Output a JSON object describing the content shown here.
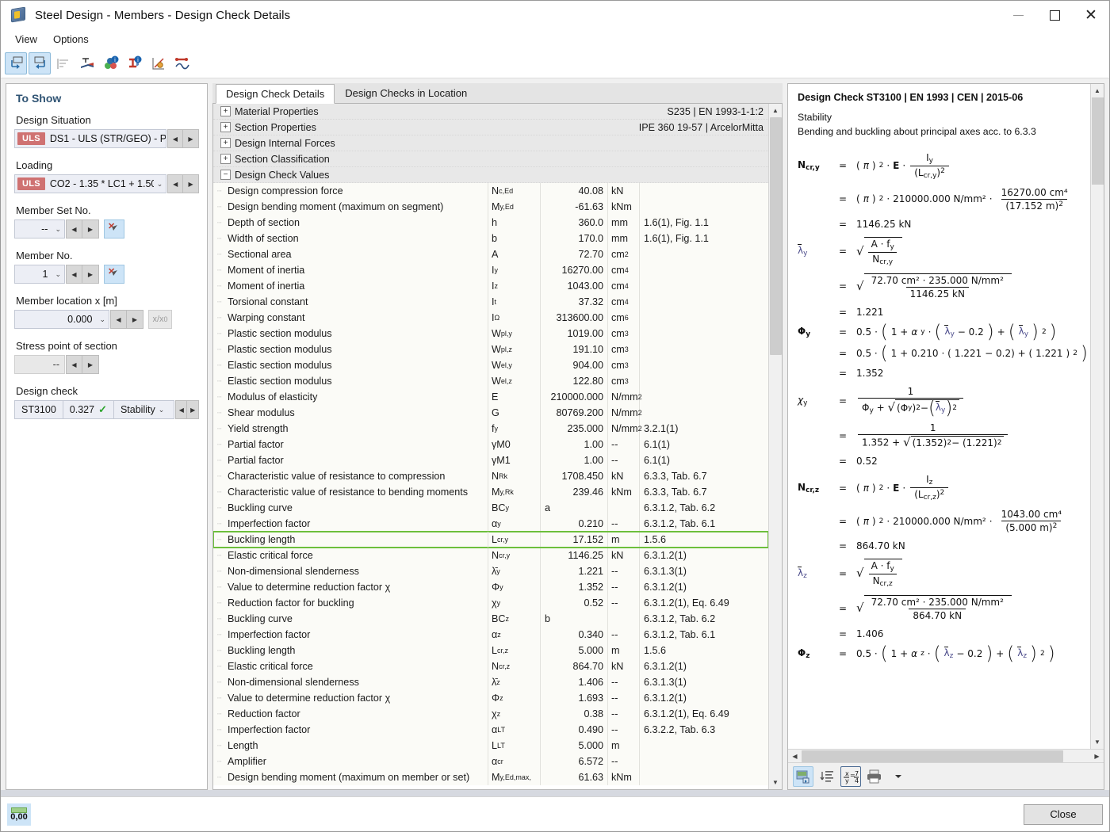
{
  "window": {
    "title": "Steel Design - Members - Design Check Details",
    "app_icon": "cube-icon",
    "minimize": "minimize-icon",
    "maximize": "maximize-icon",
    "close": "close-icon"
  },
  "menu": {
    "items": [
      "View",
      "Options"
    ]
  },
  "toolbar": {
    "buttons": [
      {
        "name": "previous-navigation-icon",
        "active": true
      },
      {
        "name": "next-navigation-icon",
        "active": true
      },
      {
        "name": "section-list-icon",
        "active": false
      },
      {
        "name": "stress-distribution-icon",
        "active": false
      },
      {
        "name": "material-info-icon",
        "active": false
      },
      {
        "name": "section-info-icon",
        "active": false
      },
      {
        "name": "diagram-icon",
        "active": false
      },
      {
        "name": "member-results-icon",
        "active": false
      }
    ]
  },
  "sidebar": {
    "title": "To Show",
    "design_situation": {
      "label": "Design Situation",
      "badge": "ULS",
      "value": "DS1 - ULS (STR/GEO) - P..."
    },
    "loading": {
      "label": "Loading",
      "badge": "ULS",
      "value": "CO2 - 1.35 * LC1 + 1.50 *"
    },
    "member_set_no": {
      "label": "Member Set No.",
      "value": "--"
    },
    "member_no": {
      "label": "Member No.",
      "value": "1"
    },
    "member_location": {
      "label": "Member location x [m]",
      "value": "0.000",
      "unit_button": "x/x",
      "unit_sub": "0"
    },
    "stress_point": {
      "label": "Stress point of section",
      "value": "--"
    },
    "design_check": {
      "label": "Design check",
      "id": "ST3100",
      "ratio": "0.327",
      "type": "Stability"
    }
  },
  "tabs": [
    {
      "label": "Design Check Details",
      "active": true
    },
    {
      "label": "Design Checks in Location",
      "active": false
    }
  ],
  "tree_groups": [
    {
      "name": "Material Properties",
      "expanded": false,
      "value": "S235 | EN 1993-1-1:2"
    },
    {
      "name": "Section Properties",
      "expanded": false,
      "value": "IPE 360 19-57 | ArcelorMitta"
    },
    {
      "name": "Design Internal Forces",
      "expanded": false,
      "value": ""
    },
    {
      "name": "Section Classification",
      "expanded": false,
      "value": ""
    },
    {
      "name": "Design Check Values",
      "expanded": true,
      "value": ""
    }
  ],
  "table": {
    "rows": [
      {
        "name": "Design compression force",
        "sym": "N",
        "sub": "c,Ed",
        "val": "40.08",
        "unit": "kN",
        "unit_sup": "",
        "ref": ""
      },
      {
        "name": "Design bending moment (maximum on segment)",
        "sym": "M",
        "sub": "y,Ed",
        "val": "-61.63",
        "unit": "kNm",
        "unit_sup": "",
        "ref": ""
      },
      {
        "name": "Depth of section",
        "sym": "h",
        "sub": "",
        "val": "360.0",
        "unit": "mm",
        "unit_sup": "",
        "ref": "1.6(1), Fig. 1.1"
      },
      {
        "name": "Width of section",
        "sym": "b",
        "sub": "",
        "val": "170.0",
        "unit": "mm",
        "unit_sup": "",
        "ref": "1.6(1), Fig. 1.1"
      },
      {
        "name": "Sectional area",
        "sym": "A",
        "sub": "",
        "val": "72.70",
        "unit": "cm",
        "unit_sup": "2",
        "ref": ""
      },
      {
        "name": "Moment of inertia",
        "sym": "I",
        "sub": "y",
        "val": "16270.00",
        "unit": "cm",
        "unit_sup": "4",
        "ref": ""
      },
      {
        "name": "Moment of inertia",
        "sym": "I",
        "sub": "z",
        "val": "1043.00",
        "unit": "cm",
        "unit_sup": "4",
        "ref": ""
      },
      {
        "name": "Torsional constant",
        "sym": "I",
        "sub": "t",
        "val": "37.32",
        "unit": "cm",
        "unit_sup": "4",
        "ref": ""
      },
      {
        "name": "Warping constant",
        "sym": "I",
        "sub": "Ω",
        "val": "313600.00",
        "unit": "cm",
        "unit_sup": "6",
        "ref": ""
      },
      {
        "name": "Plastic section modulus",
        "sym": "W",
        "sub": "pl,y",
        "val": "1019.00",
        "unit": "cm",
        "unit_sup": "3",
        "ref": ""
      },
      {
        "name": "Plastic section modulus",
        "sym": "W",
        "sub": "pl,z",
        "val": "191.10",
        "unit": "cm",
        "unit_sup": "3",
        "ref": ""
      },
      {
        "name": "Elastic section modulus",
        "sym": "W",
        "sub": "el,y",
        "val": "904.00",
        "unit": "cm",
        "unit_sup": "3",
        "ref": ""
      },
      {
        "name": "Elastic section modulus",
        "sym": "W",
        "sub": "el,z",
        "val": "122.80",
        "unit": "cm",
        "unit_sup": "3",
        "ref": ""
      },
      {
        "name": "Modulus of elasticity",
        "sym": "E",
        "sub": "",
        "val": "210000.000",
        "unit": "N/mm",
        "unit_sup": "2",
        "ref": ""
      },
      {
        "name": "Shear modulus",
        "sym": "G",
        "sub": "",
        "val": "80769.200",
        "unit": "N/mm",
        "unit_sup": "2",
        "ref": ""
      },
      {
        "name": "Yield strength",
        "sym": "f",
        "sub": "y",
        "val": "235.000",
        "unit": "N/mm",
        "unit_sup": "2",
        "ref": "3.2.1(1)"
      },
      {
        "name": "Partial factor",
        "sym": "γM0",
        "sub": "",
        "val": "1.00",
        "unit": "--",
        "unit_sup": "",
        "ref": "6.1(1)"
      },
      {
        "name": "Partial factor",
        "sym": "γM1",
        "sub": "",
        "val": "1.00",
        "unit": "--",
        "unit_sup": "",
        "ref": "6.1(1)"
      },
      {
        "name": "Characteristic value of resistance to compression",
        "sym": "N",
        "sub": "Rk",
        "val": "1708.450",
        "unit": "kN",
        "unit_sup": "",
        "ref": "6.3.3, Tab. 6.7"
      },
      {
        "name": "Characteristic value of resistance to bending moments",
        "sym": "M",
        "sub": "y,Rk",
        "val": "239.46",
        "unit": "kNm",
        "unit_sup": "",
        "ref": "6.3.3, Tab. 6.7"
      },
      {
        "name": "Buckling curve",
        "sym": "BC",
        "sub": "y",
        "val": "a",
        "unit": "",
        "unit_sup": "",
        "ref": "6.3.1.2, Tab. 6.2",
        "val_left": true
      },
      {
        "name": "Imperfection factor",
        "sym": "α",
        "sub": "y",
        "val": "0.210",
        "unit": "--",
        "unit_sup": "",
        "ref": "6.3.1.2, Tab. 6.1"
      },
      {
        "name": "Buckling length",
        "sym": "L",
        "sub": "cr,y",
        "val": "17.152",
        "unit": "m",
        "unit_sup": "",
        "ref": "1.5.6",
        "highlight": true
      },
      {
        "name": "Elastic critical force",
        "sym": "N",
        "sub": "cr,y",
        "val": "1146.25",
        "unit": "kN",
        "unit_sup": "",
        "ref": "6.3.1.2(1)"
      },
      {
        "name": "Non-dimensional slenderness",
        "sym": "λ̄",
        "sub": "y",
        "val": "1.221",
        "unit": "--",
        "unit_sup": "",
        "ref": "6.3.1.3(1)"
      },
      {
        "name": "Value to determine reduction factor χ",
        "sym": "Φ",
        "sub": "y",
        "val": "1.352",
        "unit": "--",
        "unit_sup": "",
        "ref": "6.3.1.2(1)"
      },
      {
        "name": "Reduction factor for buckling",
        "sym": "χ",
        "sub": "y",
        "val": "0.52",
        "unit": "--",
        "unit_sup": "",
        "ref": "6.3.1.2(1), Eq. 6.49"
      },
      {
        "name": "Buckling curve",
        "sym": "BC",
        "sub": "z",
        "val": "b",
        "unit": "",
        "unit_sup": "",
        "ref": "6.3.1.2, Tab. 6.2",
        "val_left": true
      },
      {
        "name": "Imperfection factor",
        "sym": "α",
        "sub": "z",
        "val": "0.340",
        "unit": "--",
        "unit_sup": "",
        "ref": "6.3.1.2, Tab. 6.1"
      },
      {
        "name": "Buckling length",
        "sym": "L",
        "sub": "cr,z",
        "val": "5.000",
        "unit": "m",
        "unit_sup": "",
        "ref": "1.5.6"
      },
      {
        "name": "Elastic critical force",
        "sym": "N",
        "sub": "cr,z",
        "val": "864.70",
        "unit": "kN",
        "unit_sup": "",
        "ref": "6.3.1.2(1)"
      },
      {
        "name": "Non-dimensional slenderness",
        "sym": "λ̄",
        "sub": "z",
        "val": "1.406",
        "unit": "--",
        "unit_sup": "",
        "ref": "6.3.1.3(1)"
      },
      {
        "name": "Value to determine reduction factor χ",
        "sym": "Φ",
        "sub": "z",
        "val": "1.693",
        "unit": "--",
        "unit_sup": "",
        "ref": "6.3.1.2(1)"
      },
      {
        "name": "Reduction factor",
        "sym": "χ",
        "sub": "z",
        "val": "0.38",
        "unit": "--",
        "unit_sup": "",
        "ref": "6.3.1.2(1), Eq. 6.49"
      },
      {
        "name": "Imperfection factor",
        "sym": "α",
        "sub": "LT",
        "val": "0.490",
        "unit": "--",
        "unit_sup": "",
        "ref": "6.3.2.2, Tab. 6.3"
      },
      {
        "name": "Length",
        "sym": "L",
        "sub": "LT",
        "val": "5.000",
        "unit": "m",
        "unit_sup": "",
        "ref": ""
      },
      {
        "name": "Amplifier",
        "sym": "α",
        "sub": "cr",
        "val": "6.572",
        "unit": "--",
        "unit_sup": "",
        "ref": ""
      },
      {
        "name": "Design bending moment (maximum on member or set)",
        "sym": "M",
        "sub": "y,Ed,max,",
        "val": "61.63",
        "unit": "kNm",
        "unit_sup": "",
        "ref": ""
      }
    ]
  },
  "detail": {
    "title": "Design Check ST3100 | EN 1993 | CEN | 2015-06",
    "subtitle_1": "Stability",
    "subtitle_2": "Bending and buckling about principal axes acc. to 6.3.3",
    "values": {
      "E": "210000.000 N/mm²",
      "Iy": "16270.00 cm⁴",
      "Iz": "1043.00 cm⁴",
      "Lcry": "17.152 m",
      "Lcrz": "5.000 m",
      "Ncry": "1146.25 kN",
      "Ncrz": "864.70 kN",
      "A": "72.70 cm²",
      "fy": "235.000 N/mm²",
      "lambda_y": "1.221",
      "lambda_z": "1.406",
      "alpha_y": "0.210",
      "alpha_z": "0.340",
      "phi_y": "1.352",
      "chi_y": "0.52",
      "const_05": "0.5",
      "const_1": "1",
      "const_02": "0.2"
    },
    "toolbar": [
      {
        "name": "export-image-icon",
        "selected": true
      },
      {
        "name": "list-detail-icon",
        "selected": false
      },
      {
        "name": "formula-toggle-icon",
        "selected": false,
        "boxed": true
      },
      {
        "name": "print-icon",
        "selected": false
      },
      {
        "name": "print-dropdown-icon",
        "selected": false
      }
    ]
  },
  "bottom": {
    "units_button": "units-icon",
    "units_value": "0,00",
    "close_label": "Close"
  }
}
